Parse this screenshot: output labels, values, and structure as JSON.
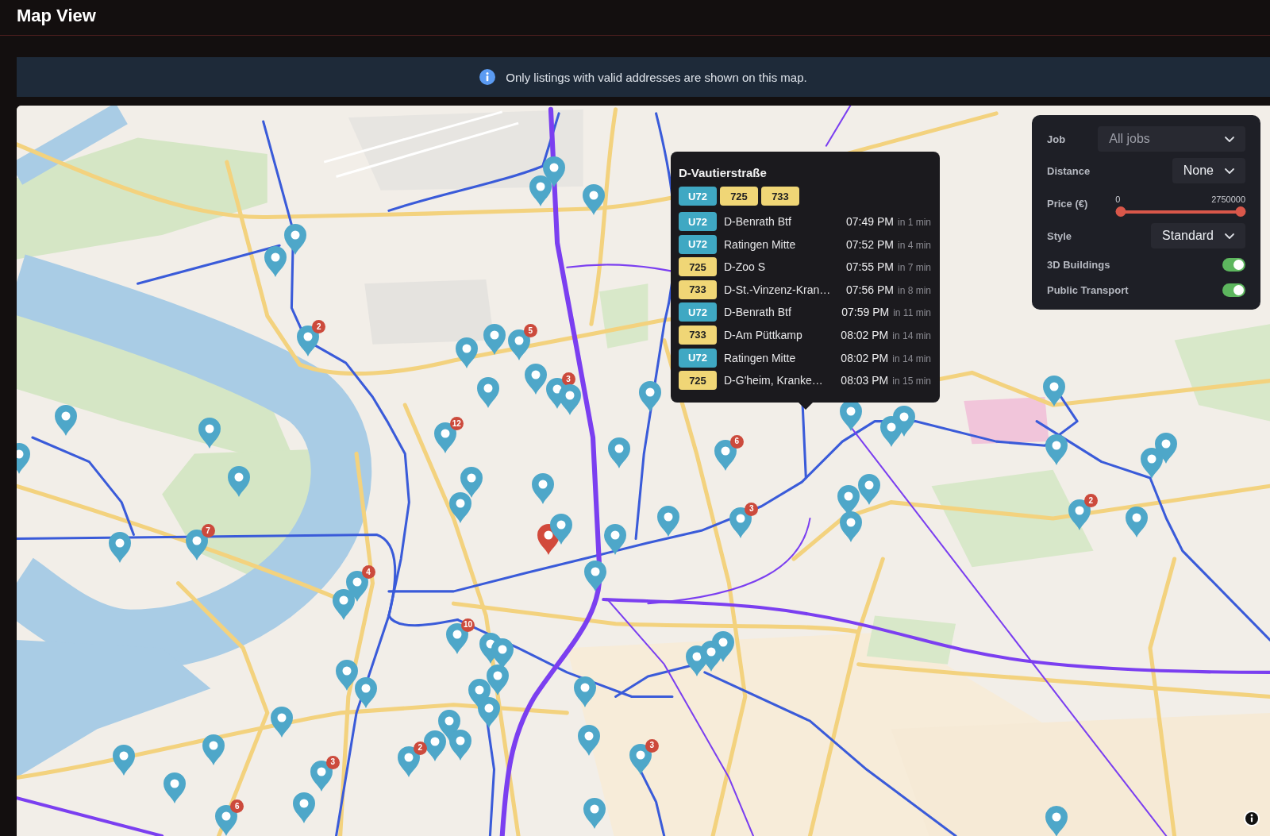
{
  "header": {
    "title": "Map View"
  },
  "notice": {
    "text": "Only listings with valid addresses are shown on this map."
  },
  "map": {
    "markers": [
      {
        "selected": false
      },
      {
        "selected": false
      },
      {
        "selected": false
      },
      {
        "selected": false
      },
      {
        "selected": false
      },
      {
        "selected": false,
        "count": "2"
      },
      {
        "selected": false
      },
      {
        "selected": false
      },
      {
        "selected": false,
        "count": "5"
      },
      {
        "selected": false
      },
      {
        "selected": false
      },
      {
        "selected": false,
        "count": "3"
      },
      {
        "selected": false
      },
      {
        "selected": false
      },
      {
        "selected": false,
        "count": "12"
      },
      {
        "selected": false
      },
      {
        "selected": false
      },
      {
        "selected": false
      },
      {
        "selected": false
      },
      {
        "selected": false
      },
      {
        "selected": false
      },
      {
        "selected": false
      },
      {
        "selected": false
      },
      {
        "selected": false,
        "count": "6"
      },
      {
        "selected": true
      },
      {
        "selected": false
      },
      {
        "selected": false
      },
      {
        "selected": false
      },
      {
        "selected": false,
        "count": "3"
      },
      {
        "selected": false
      },
      {
        "selected": false
      },
      {
        "selected": false
      },
      {
        "selected": false
      },
      {
        "selected": false
      },
      {
        "selected": false
      },
      {
        "selected": false
      },
      {
        "selected": false
      },
      {
        "selected": false
      },
      {
        "selected": false
      },
      {
        "selected": false,
        "count": "2"
      },
      {
        "selected": false
      },
      {
        "selected": false
      },
      {
        "selected": false,
        "count": "7"
      },
      {
        "selected": false
      },
      {
        "selected": false,
        "count": "4"
      },
      {
        "selected": false
      },
      {
        "selected": false,
        "count": "10"
      },
      {
        "selected": false
      },
      {
        "selected": false
      },
      {
        "selected": false
      },
      {
        "selected": false
      },
      {
        "selected": false
      },
      {
        "selected": false
      },
      {
        "selected": false
      },
      {
        "selected": false
      },
      {
        "selected": false
      },
      {
        "selected": false
      },
      {
        "selected": false
      },
      {
        "selected": false
      },
      {
        "selected": false
      },
      {
        "selected": false
      },
      {
        "selected": false
      },
      {
        "selected": false,
        "count": "2"
      },
      {
        "selected": false
      },
      {
        "selected": false,
        "count": "3"
      },
      {
        "selected": false
      },
      {
        "selected": false
      },
      {
        "selected": false,
        "count": "3"
      },
      {
        "selected": false
      },
      {
        "selected": false
      },
      {
        "selected": false,
        "count": "6"
      },
      {
        "selected": false
      },
      {
        "selected": false
      }
    ],
    "popup": {
      "title": "D-Vautierstraße",
      "lines": [
        {
          "name": "U72",
          "kind": "tram"
        },
        {
          "name": "725",
          "kind": "bus"
        },
        {
          "name": "733",
          "kind": "bus"
        }
      ],
      "departures": [
        {
          "line": "U72",
          "kind": "tram",
          "destination": "D-Benrath Btf",
          "time": "07:49 PM",
          "eta": "in 1 min"
        },
        {
          "line": "U72",
          "kind": "tram",
          "destination": "Ratingen Mitte",
          "time": "07:52 PM",
          "eta": "in 4 min"
        },
        {
          "line": "725",
          "kind": "bus",
          "destination": "D-Zoo S",
          "time": "07:55 PM",
          "eta": "in 7 min"
        },
        {
          "line": "733",
          "kind": "bus",
          "destination": "D-St.-Vinzenz-Kran…",
          "time": "07:56 PM",
          "eta": "in 8 min"
        },
        {
          "line": "U72",
          "kind": "tram",
          "destination": "D-Benrath Btf",
          "time": "07:59 PM",
          "eta": "in 11 min"
        },
        {
          "line": "733",
          "kind": "bus",
          "destination": "D-Am Püttkamp",
          "time": "08:02 PM",
          "eta": "in 14 min"
        },
        {
          "line": "U72",
          "kind": "tram",
          "destination": "Ratingen Mitte",
          "time": "08:02 PM",
          "eta": "in 14 min"
        },
        {
          "line": "725",
          "kind": "bus",
          "destination": "D-G'heim, Kranke…",
          "time": "08:03 PM",
          "eta": "in 15 min"
        }
      ]
    },
    "filters": [
      {
        "kind": "select",
        "label": "Job",
        "placeholder": "All jobs"
      },
      {
        "kind": "select",
        "label": "Distance",
        "value": "None"
      },
      {
        "kind": "range",
        "label": "Price (€)",
        "min_label": "0",
        "max_label": "2750000",
        "thumbs": [
          {
            "level": 0
          },
          {
            "level": 1
          }
        ]
      },
      {
        "kind": "select",
        "label": "Style",
        "value": "Standard"
      },
      {
        "kind": "toggle",
        "label": "3D Buildings",
        "on": true
      },
      {
        "kind": "toggle",
        "label": "Public Transport",
        "on": true
      }
    ]
  }
}
